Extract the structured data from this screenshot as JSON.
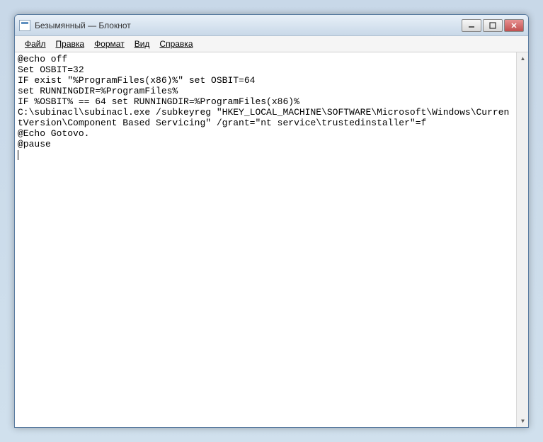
{
  "window": {
    "title": "Безымянный — Блокнот"
  },
  "menu": {
    "file": "Файл",
    "edit": "Правка",
    "format": "Формат",
    "view": "Вид",
    "help": "Справка"
  },
  "content": {
    "text": "@echo off\nSet OSBIT=32\nIF exist \"%ProgramFiles(x86)%\" set OSBIT=64\nset RUNNINGDIR=%ProgramFiles%\nIF %OSBIT% == 64 set RUNNINGDIR=%ProgramFiles(x86)%\nC:\\subinacl\\subinacl.exe /subkeyreg \"HKEY_LOCAL_MACHINE\\SOFTWARE\\Microsoft\\Windows\\CurrentVersion\\Component Based Servicing\" /grant=\"nt service\\trustedinstaller\"=f\n@Echo Gotovo.\n@pause"
  }
}
